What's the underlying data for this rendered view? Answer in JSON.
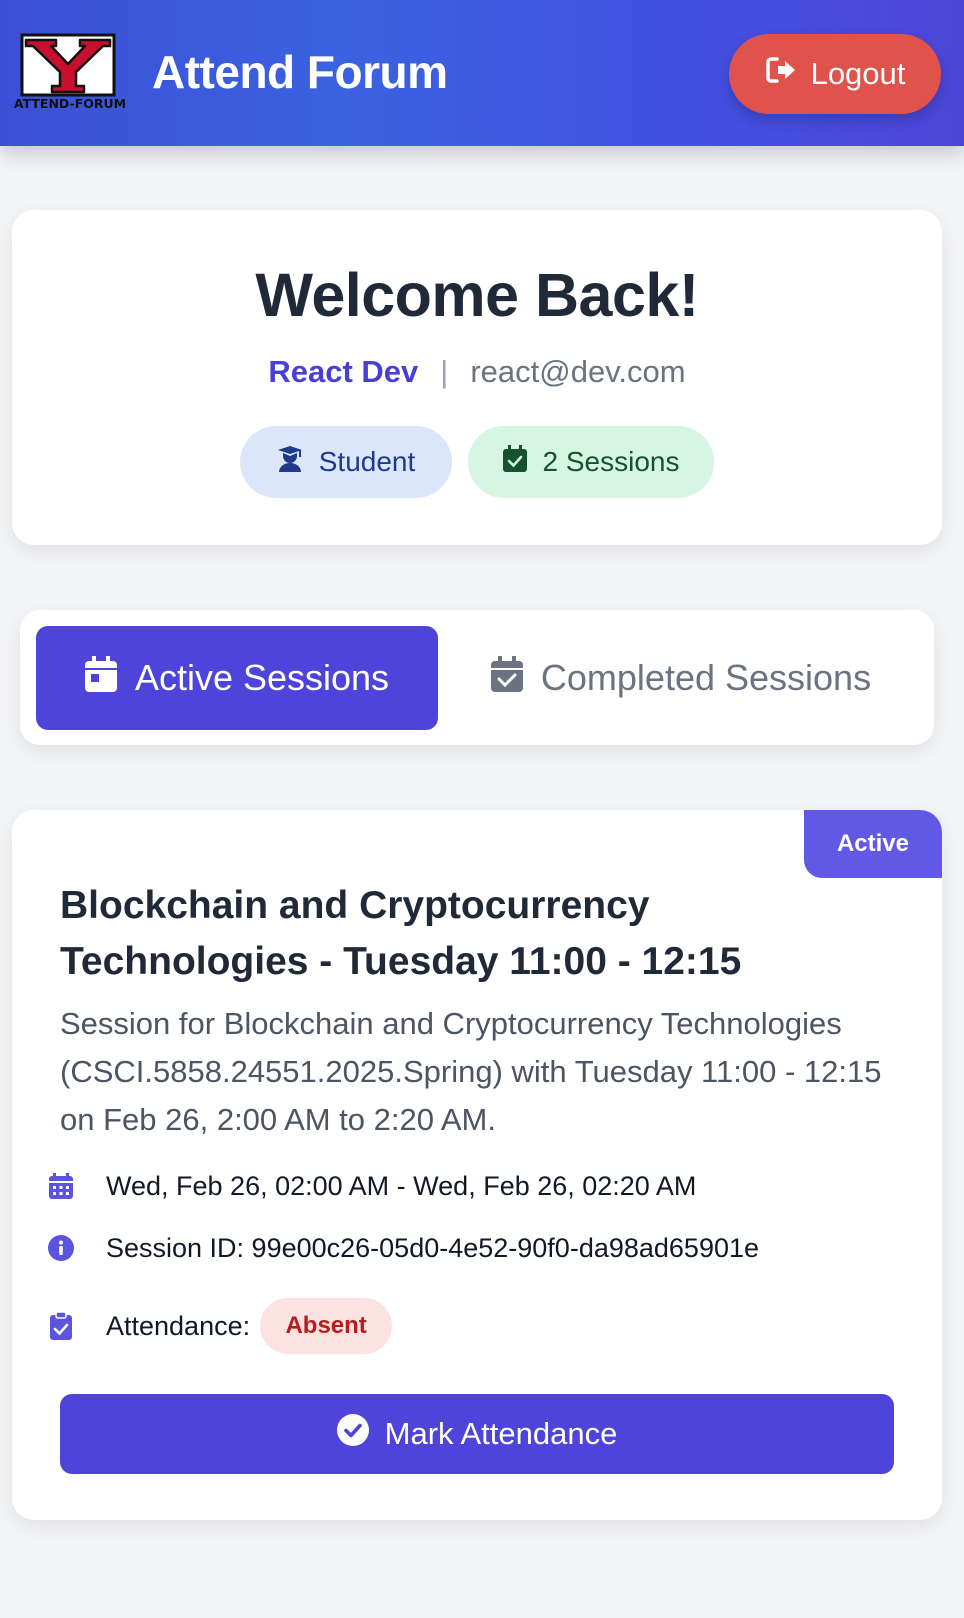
{
  "header": {
    "logo_text": "ATTEND-FORUM",
    "title": "Attend Forum",
    "logout_label": "Logout"
  },
  "welcome": {
    "title": "Welcome Back!",
    "user_name": "React Dev",
    "separator": "|",
    "email": "react@dev.com",
    "role_badge": "Student",
    "sessions_badge": "2 Sessions"
  },
  "tabs": [
    {
      "label": "Active Sessions",
      "active": true
    },
    {
      "label": "Completed Sessions",
      "active": false
    }
  ],
  "session": {
    "status": "Active",
    "title": "Blockchain and Cryptocurrency Technologies - Tuesday 11:00 - 12:15",
    "description": "Session for Blockchain and Cryptocurrency Technologies (CSCI.5858.24551.2025.Spring) with Tuesday 11:00 - 12:15 on Feb 26, 2:00 AM to 2:20 AM.",
    "time_range": "Wed, Feb 26, 02:00 AM - Wed, Feb 26, 02:20 AM",
    "session_id": "Session ID: 99e00c26-05d0-4e52-90f0-da98ad65901e",
    "attendance_label": "Attendance:",
    "attendance_status": "Absent",
    "mark_button": "Mark Attendance"
  },
  "colors": {
    "primary": "#4e44d9",
    "header_gradient_start": "#3b4fd6",
    "logout": "#e0524c",
    "absent_bg": "#fde2e2",
    "absent_text": "#b91c1c",
    "student_bg": "#dbe6fb",
    "sessions_bg": "#d6f5e2"
  },
  "icons": {
    "logo": "ysu-y-logo",
    "logout": "sign-out-icon",
    "student": "user-graduate-icon",
    "sessions": "calendar-check-icon",
    "active_tab": "calendar-icon",
    "completed_tab": "calendar-check-icon",
    "time": "calendar-days-icon",
    "session_id": "info-circle-icon",
    "attendance": "clipboard-check-icon",
    "mark": "check-circle-icon"
  }
}
